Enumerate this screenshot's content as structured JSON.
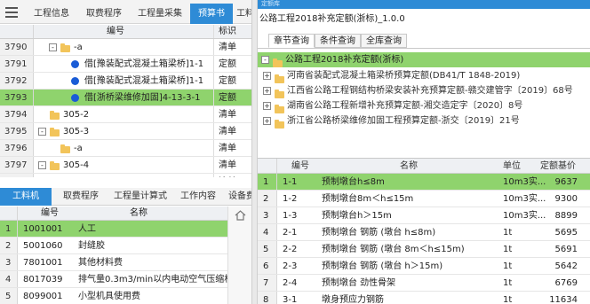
{
  "top_tabs": [
    {
      "label": "工程信息",
      "active": false
    },
    {
      "label": "取费程序",
      "active": false
    },
    {
      "label": "工程量采集",
      "active": false
    },
    {
      "label": "预算书",
      "active": true
    },
    {
      "label": "工料",
      "active": false
    }
  ],
  "left_grid": {
    "col_code": "编号",
    "col_type": "标识",
    "rows": [
      {
        "num": "3790",
        "text": "-a",
        "type": "清单",
        "kind": "folder",
        "indent": 2,
        "expander": "-"
      },
      {
        "num": "3791",
        "text": "借[豫装配式混凝土箱梁桥]1-1",
        "type": "定额",
        "kind": "dot",
        "indent": 3
      },
      {
        "num": "3792",
        "text": "借[豫装配式混凝土箱梁桥]1-1",
        "type": "定额",
        "kind": "dot",
        "indent": 3
      },
      {
        "num": "3793",
        "text": "借[浙桥梁维修加固]4-13-3-1",
        "type": "定额",
        "kind": "dot",
        "indent": 3,
        "selected": true
      },
      {
        "num": "3794",
        "text": "305-2",
        "type": "清单",
        "kind": "folder",
        "indent": 1
      },
      {
        "num": "3795",
        "text": "305-3",
        "type": "清单",
        "kind": "folder",
        "indent": 1,
        "expander": "-"
      },
      {
        "num": "3796",
        "text": "-a",
        "type": "清单",
        "kind": "folder",
        "indent": 2
      },
      {
        "num": "3797",
        "text": "305-4",
        "type": "清单",
        "kind": "folder",
        "indent": 1,
        "expander": "-"
      },
      {
        "num": "3798",
        "text": "-a",
        "type": "清单",
        "kind": "folder",
        "indent": 2
      }
    ]
  },
  "bottom_tabs": [
    {
      "label": "工料机",
      "active": true
    },
    {
      "label": "取费程序",
      "active": false
    },
    {
      "label": "工程量计算式",
      "active": false
    },
    {
      "label": "工作内容",
      "active": false
    },
    {
      "label": "设备费",
      "active": false
    }
  ],
  "bottom_grid": {
    "col_code": "编号",
    "col_name": "名称",
    "rows": [
      {
        "num": "1",
        "code": "1001001",
        "name": "人工",
        "selected": true
      },
      {
        "num": "2",
        "code": "5001060",
        "name": "封缝胶"
      },
      {
        "num": "3",
        "code": "7801001",
        "name": "其他材料费"
      },
      {
        "num": "4",
        "code": "8017039",
        "name": "排气量0.3m3/min以内电动空气压缩机"
      },
      {
        "num": "5",
        "code": "8099001",
        "name": "小型机具使用费"
      }
    ]
  },
  "right_panel": {
    "title": "定额库",
    "library_name": "公路工程2018补充定额(浙标)_1.0.0",
    "query_tabs": [
      {
        "label": "章节查询",
        "active": true
      },
      {
        "label": "条件查询",
        "active": false
      },
      {
        "label": "全库查询",
        "active": false
      }
    ],
    "tree": [
      {
        "text": "公路工程2018补充定额(浙标)",
        "level": 0,
        "selected": true,
        "expander": "-"
      },
      {
        "text": "河南省装配式混凝土箱梁桥预算定额(DB41/T 1848-2019)",
        "level": 1,
        "expander": "+"
      },
      {
        "text": "江西省公路工程钢结构桥梁安装补充预算定额-赣交建管字〔2019〕68号",
        "level": 1,
        "expander": "+"
      },
      {
        "text": "湖南省公路工程新增补充预算定额-湘交造定字〔2020〕8号",
        "level": 1,
        "expander": "+"
      },
      {
        "text": "浙江省公路桥梁维修加固工程预算定额-浙交〔2019〕21号",
        "level": 1,
        "expander": "+"
      }
    ],
    "grid": {
      "col_code": "编号",
      "col_name": "名称",
      "col_unit": "单位",
      "col_price": "定额基价",
      "rows": [
        {
          "num": "1",
          "code": "1-1",
          "name": "预制墩台h≤8m",
          "unit": "10m3实...",
          "price": "9637",
          "selected": true
        },
        {
          "num": "2",
          "code": "1-2",
          "name": "预制墩台8m＜h≤15m",
          "unit": "10m3实...",
          "price": "9300"
        },
        {
          "num": "3",
          "code": "1-3",
          "name": "预制墩台h＞15m",
          "unit": "10m3实...",
          "price": "8899"
        },
        {
          "num": "4",
          "code": "2-1",
          "name": "预制墩台 钢筋 (墩台 h≤8m)",
          "unit": "1t",
          "price": "5695"
        },
        {
          "num": "5",
          "code": "2-2",
          "name": "预制墩台 钢筋 (墩台 8m＜h≤15m)",
          "unit": "1t",
          "price": "5691"
        },
        {
          "num": "6",
          "code": "2-3",
          "name": "预制墩台 钢筋 (墩台 h＞15m)",
          "unit": "1t",
          "price": "5642"
        },
        {
          "num": "7",
          "code": "2-4",
          "name": "预制墩台 劲性骨架",
          "unit": "1t",
          "price": "6769"
        },
        {
          "num": "8",
          "code": "3-1",
          "name": "墩身预应力钢筋",
          "unit": "1t",
          "price": "11634"
        }
      ]
    }
  },
  "colors": {
    "accent": "#2e8bd6",
    "selected": "#8fd36d",
    "dot": "#1a5cd6",
    "folder": "#f2c45a"
  }
}
